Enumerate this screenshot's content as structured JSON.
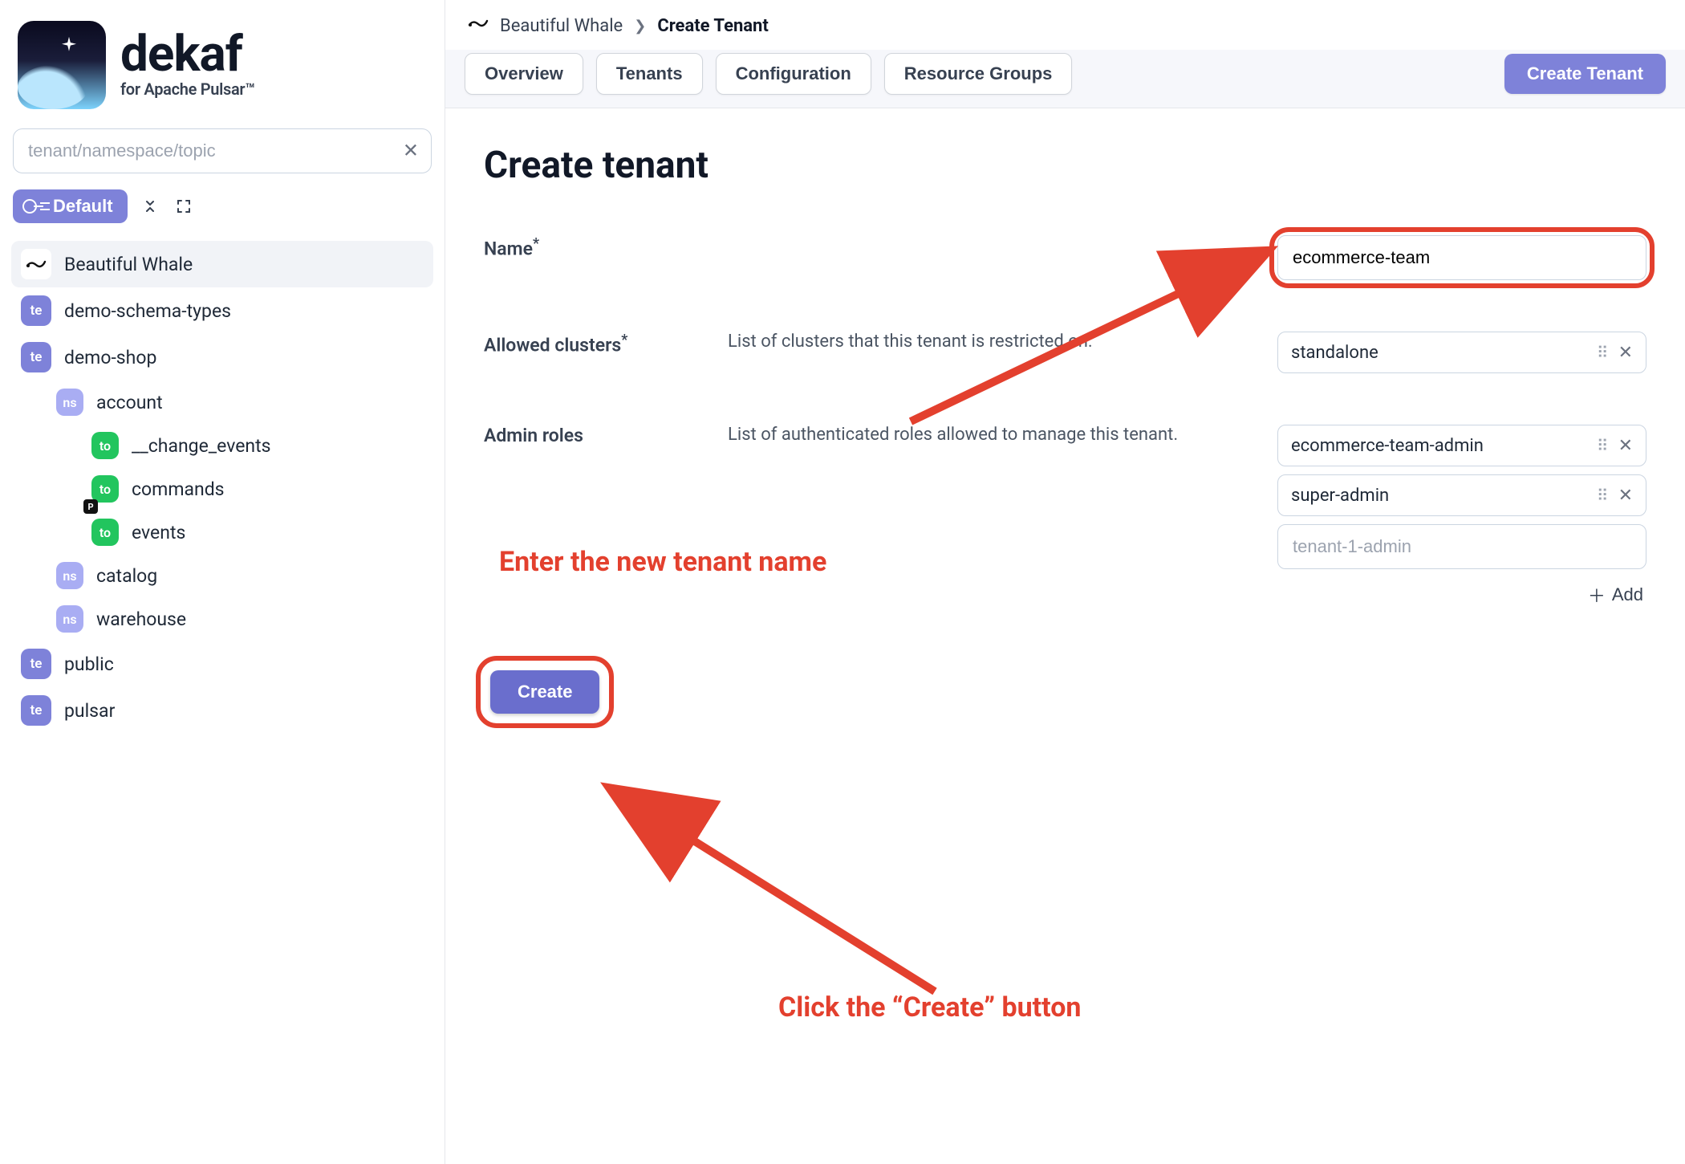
{
  "brand": {
    "name": "dekaf",
    "subtitle": "for Apache Pulsar™"
  },
  "sidebar": {
    "search_placeholder": "tenant/namespace/topic",
    "default_badge": "Default",
    "clusters": [
      {
        "label": "Beautiful Whale",
        "selected": true
      }
    ],
    "tree": [
      {
        "type": "te",
        "label": "demo-schema-types"
      },
      {
        "type": "te",
        "label": "demo-shop",
        "children": [
          {
            "type": "ns",
            "label": "account",
            "children": [
              {
                "type": "to",
                "label": "__change_events"
              },
              {
                "type": "to",
                "label": "commands"
              },
              {
                "type": "to",
                "label": "events",
                "pinned": true
              }
            ]
          },
          {
            "type": "ns",
            "label": "catalog"
          },
          {
            "type": "ns",
            "label": "warehouse"
          }
        ]
      },
      {
        "type": "te",
        "label": "public"
      },
      {
        "type": "te",
        "label": "pulsar"
      }
    ]
  },
  "breadcrumb": {
    "items": [
      "Beautiful Whale",
      "Create Tenant"
    ]
  },
  "tabs": [
    {
      "label": "Overview"
    },
    {
      "label": "Tenants"
    },
    {
      "label": "Configuration"
    },
    {
      "label": "Resource Groups"
    }
  ],
  "header_action": "Create Tenant",
  "page": {
    "title": "Create tenant",
    "fields": {
      "name": {
        "label": "Name",
        "value": "ecommerce-team"
      },
      "allowed_clusters": {
        "label": "Allowed clusters",
        "desc": "List of clusters that this tenant is restricted on.",
        "values": [
          "standalone"
        ]
      },
      "admin_roles": {
        "label": "Admin roles",
        "desc": "List of authenticated roles allowed to manage this tenant.",
        "values": [
          "ecommerce-team-admin",
          "super-admin"
        ],
        "placeholder": "tenant-1-admin",
        "add_label": "Add"
      }
    },
    "submit_label": "Create"
  },
  "annotations": {
    "name_hint": "Enter the new tenant name",
    "submit_hint": "Click the “Create” button"
  },
  "colors": {
    "accent": "#7e82d9",
    "annotation": "#e3402e",
    "topic_badge": "#22c55e"
  }
}
